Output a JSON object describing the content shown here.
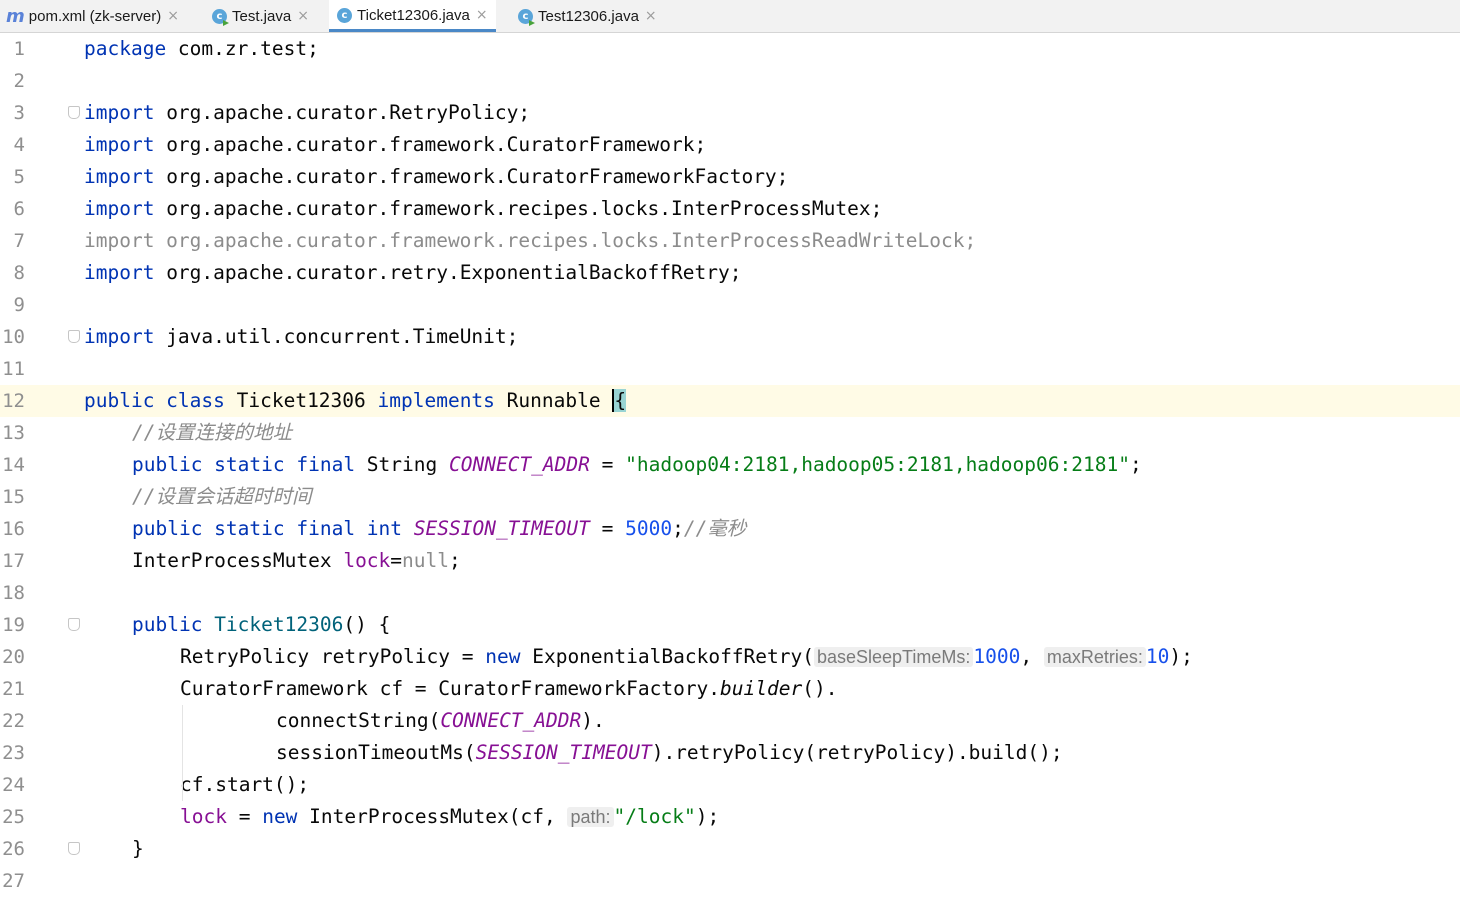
{
  "tabs": [
    {
      "label": "pom.xml (zk-server)",
      "icon": "maven-icon"
    },
    {
      "label": "Test.java",
      "icon": "java-class-icon"
    },
    {
      "label": "Ticket12306.java",
      "icon": "java-class-icon",
      "active": true
    },
    {
      "label": "Test12306.java",
      "icon": "java-class-icon"
    }
  ],
  "editor": {
    "line_numbers": [
      "1",
      "2",
      "3",
      "4",
      "5",
      "6",
      "7",
      "8",
      "9",
      "10",
      "11",
      "12",
      "13",
      "14",
      "15",
      "16",
      "17",
      "18",
      "19",
      "20",
      "21",
      "22",
      "23",
      "24",
      "25",
      "26",
      "27"
    ],
    "current_line": 12,
    "code": {
      "l1_kw": "package",
      "l1_rest": " com.zr.test;",
      "import_kw": "import",
      "l3": " org.apache.curator.RetryPolicy;",
      "l4": " org.apache.curator.framework.CuratorFramework;",
      "l5": " org.apache.curator.framework.CuratorFrameworkFactory;",
      "l6": " org.apache.curator.framework.recipes.locks.InterProcessMutex;",
      "l7": "import org.apache.curator.framework.recipes.locks.InterProcessReadWriteLock;",
      "l8": " org.apache.curator.retry.ExponentialBackoffRetry;",
      "l10": " java.util.concurrent.TimeUnit;",
      "l12_public_class": "public class",
      "l12_name": " Ticket12306 ",
      "l12_implements": "implements",
      "l12_runnable": " Runnable ",
      "l12_brace": "{",
      "l13_comment": "//设置连接的地址",
      "psf": "public static final",
      "l14_type": " String ",
      "l14_const": "CONNECT_ADDR",
      "l14_eq": " = ",
      "l14_str": "\"hadoop04:2181,hadoop05:2181,hadoop06:2181\"",
      "semi": ";",
      "l15_comment": "//设置会话超时时间",
      "l16_type": " int ",
      "l16_const": "SESSION_TIMEOUT",
      "l16_eq": " = ",
      "l16_num": "5000",
      "l16_comment": "//毫秒",
      "l17_type": "InterProcessMutex ",
      "l17_field": "lock",
      "l17_eq": "=",
      "l17_null": "null",
      "public_kw": "public",
      "l19_ctor": " Ticket12306",
      "l19_rest": "() {",
      "l20_a": "RetryPolicy retryPolicy = ",
      "new_kw": "new",
      "l20_b": " ExponentialBackoffRetry(",
      "l20_hint1": "baseSleepTimeMs:",
      "l20_num1": "1000",
      "l20_comma": ", ",
      "l20_hint2": "maxRetries:",
      "l20_num2": "10",
      "l20_end": ");",
      "l21_a": "CuratorFramework cf = CuratorFrameworkFactory.",
      "l21_builder": "builder",
      "l21_end": "().",
      "l22_a": "connectString(",
      "l22_end": ").",
      "l23_a": "sessionTimeoutMs(",
      "l23_end": ").retryPolicy(retryPolicy).build();",
      "l24": "cf.start();",
      "l25_eq": " = ",
      "l25_b": " InterProcessMutex(cf, ",
      "l25_hint": "path:",
      "l25_str": "\"/lock\"",
      "l25_end": ");",
      "l26": "}"
    }
  },
  "colors": {
    "keyword": "#0033b3",
    "string": "#067d17",
    "number": "#1750eb",
    "constant": "#871094",
    "comment": "#8c8c8c",
    "current_line": "#fffbe6",
    "active_tab_underline": "#4a88c7"
  }
}
